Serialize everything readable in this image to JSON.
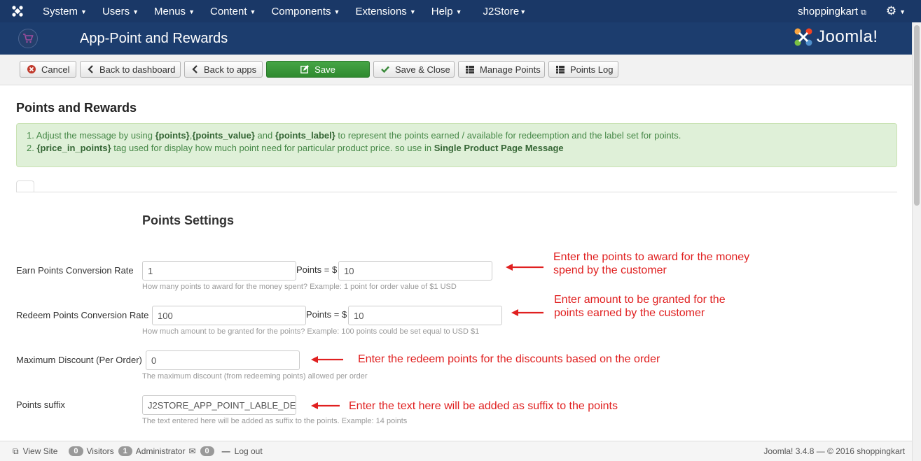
{
  "topnav": {
    "menu": [
      "System",
      "Users",
      "Menus",
      "Content",
      "Components",
      "Extensions",
      "Help",
      "J2Store"
    ],
    "user": "shoppingkart"
  },
  "header": {
    "title": "App-Point and Rewards",
    "brand": "Joomla!"
  },
  "toolbar": {
    "cancel": "Cancel",
    "back_dashboard": "Back to dashboard",
    "back_apps": "Back to apps",
    "save": "Save",
    "save_close": "Save & Close",
    "manage_points": "Manage Points",
    "points_log": "Points Log"
  },
  "content": {
    "page_title": "Points and Rewards",
    "alert": {
      "line1": {
        "prefix": "1. Adjust the message by using ",
        "t1": "{points}",
        "sep1": ",",
        "t2": "{points_value}",
        "and": " and ",
        "t3": "{points_label}",
        "suffix": " to represent the points earned / available for redeemption and the label set for points."
      },
      "line2": {
        "prefix": "2. ",
        "t1": "{price_in_points}",
        "mid": " tag used for display how much point need for particular product price. so use in ",
        "t2": "Single Product Page Message"
      }
    },
    "section_title": "Points Settings",
    "fields": {
      "earn": {
        "label": "Earn Points Conversion Rate",
        "value1": "1",
        "mid": "Points = $",
        "value2": "10",
        "help": "How many points to award for the money spent? Example: 1 point for order value of $1 USD"
      },
      "redeem": {
        "label": "Redeem Points Conversion Rate",
        "value1": "100",
        "mid": "Points = $",
        "value2": "10",
        "help": "How much amount to be granted for the points? Example: 100 points could be set equal to USD $1"
      },
      "max_discount": {
        "label": "Maximum Discount (Per Order)",
        "value": "0",
        "help": "The maximum discount (from redeeming points) allowed per order"
      },
      "suffix": {
        "label": "Points suffix",
        "value": "J2STORE_APP_POINT_LABLE_DE",
        "help": "The text entered here will be added as suffix to the points. Example: 14 points"
      }
    },
    "annotations": {
      "earn_1": "Enter the points to award for the money",
      "earn_2": "spend by the customer",
      "redeem_1": "Enter amount to be granted for the",
      "redeem_2": "points earned by the customer",
      "discount": "Enter the redeem points for the discounts based on the order",
      "suffix": "Enter the text here will be added as suffix to the points"
    }
  },
  "statusbar": {
    "view_site": "View Site",
    "visitors_count": "0",
    "visitors": "Visitors",
    "admin_count": "1",
    "admin": "Administrator",
    "messages_count": "0",
    "logout": "Log out",
    "copyright": "Joomla! 3.4.8  —  © 2016 shoppingkart"
  }
}
